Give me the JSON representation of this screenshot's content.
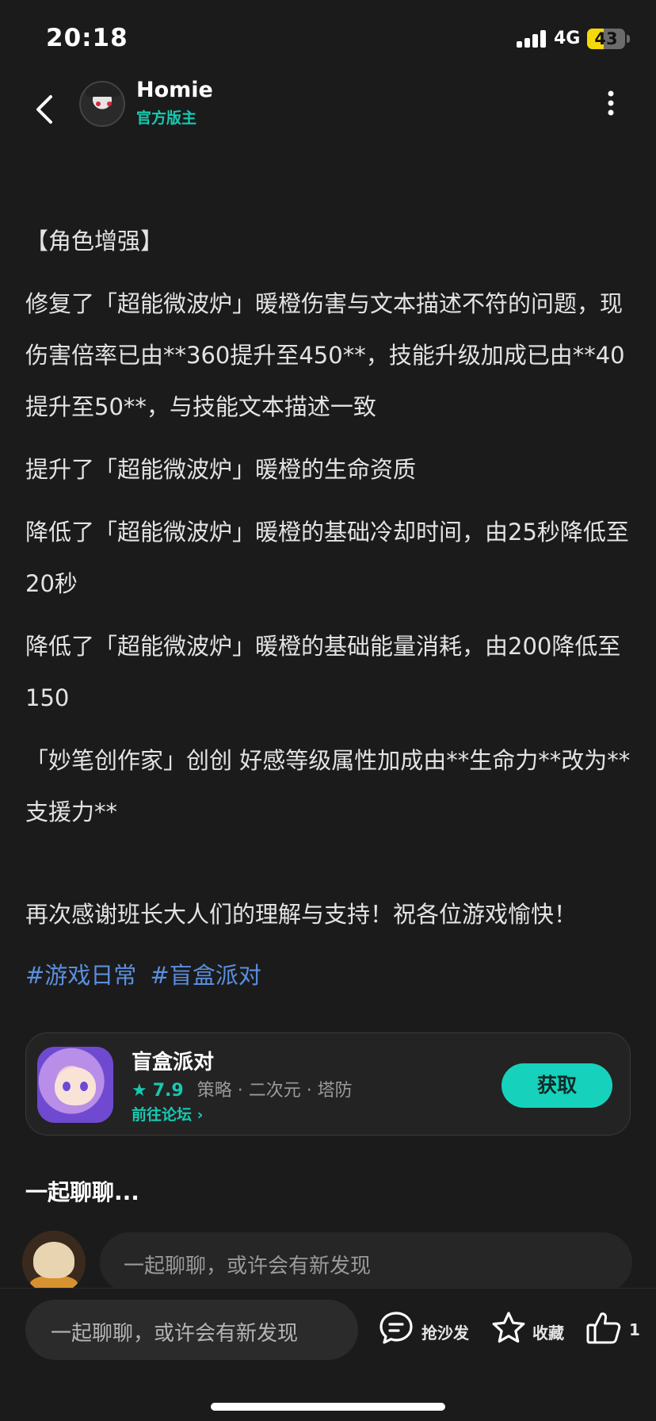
{
  "status_bar": {
    "time": "20:18",
    "network": "4G",
    "battery_level": "43",
    "battery_fraction": 0.43
  },
  "header": {
    "user_name": "Homie",
    "user_role": "官方版主"
  },
  "post": {
    "paragraphs": [
      "【角色增强】",
      "修复了「超能微波炉」暖橙伤害与文本描述不符的问题，现伤害倍率已由**360提升至450**，技能升级加成已由**40提升至50**，与技能文本描述一致",
      "提升了「超能微波炉」暖橙的生命资质",
      "降低了「超能微波炉」暖橙的基础冷却时间，由25秒降低至20秒",
      "降低了「超能微波炉」暖橙的基础能量消耗，由200降低至150",
      "「妙笔创作家」创创 好感等级属性加成由**生命力**改为**支援力**",
      "再次感谢班长大人们的理解与支持！祝各位游戏愉快！"
    ],
    "tags": [
      "#游戏日常",
      "#盲盒派对"
    ]
  },
  "game_card": {
    "name": "盲盒派对",
    "star": "★",
    "rating": "7.9",
    "categories": "策略 · 二次元 · 塔防",
    "forum_link": "前往论坛 ›",
    "get_label": "获取",
    "accent_color": "#16d2bd"
  },
  "chat": {
    "title": "一起聊聊...",
    "input_placeholder": "一起聊聊，或许会有新发现"
  },
  "bottom_bar": {
    "input_placeholder": "一起聊聊，或许会有新发现",
    "sofa_label": "抢沙发",
    "favorite_label": "收藏",
    "like_count": "1",
    "icons": [
      "comment-icon",
      "star-icon",
      "thumbs-up-icon"
    ]
  }
}
